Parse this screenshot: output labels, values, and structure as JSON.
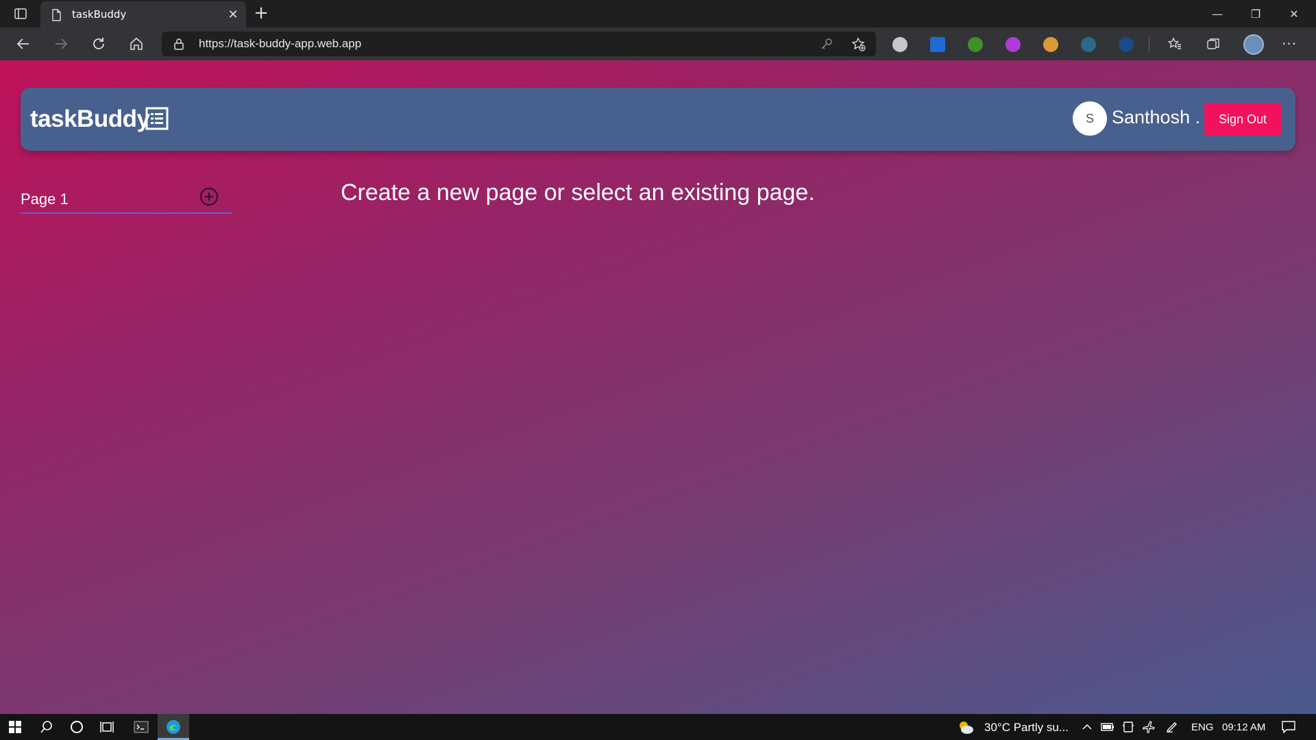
{
  "browser": {
    "tab_title": "taskBuddy",
    "url": "https://task-buddy-app.web.app"
  },
  "app": {
    "brand": "taskBuddy",
    "user_initial": "S",
    "user_name": "Santhosh .",
    "sign_out_label": "Sign Out",
    "pages": [
      {
        "label": "Page 1"
      }
    ],
    "empty_message": "Create a new page or select an existing page."
  },
  "taskbar": {
    "weather": "30°C  Partly su...",
    "language": "ENG",
    "time": "09:12 AM"
  },
  "colors": {
    "accent": "#f0125d",
    "navbar": "#48608e",
    "gradient_start": "#c0125a",
    "gradient_end": "#4a5a8e"
  }
}
